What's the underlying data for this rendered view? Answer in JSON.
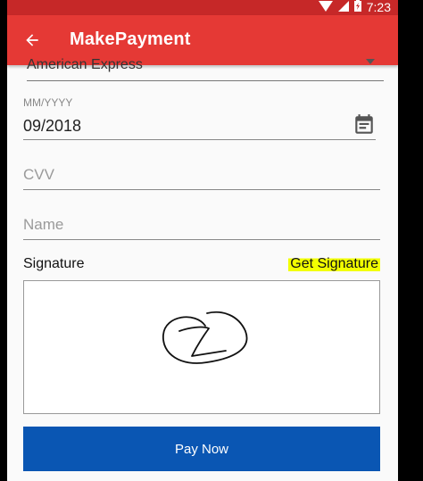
{
  "status_bar": {
    "time": "7:23",
    "icons": [
      "wifi-icon",
      "signal-icon",
      "battery-icon"
    ]
  },
  "appbar": {
    "title": "MakePayment",
    "back_icon": "arrow-back-icon"
  },
  "form": {
    "card_type": {
      "value": "American Express"
    },
    "expiry": {
      "label": "MM/YYYY",
      "value": "09/2018",
      "icon": "calendar-icon"
    },
    "cvv": {
      "placeholder": "CVV",
      "value": ""
    },
    "name": {
      "placeholder": "Name",
      "value": ""
    },
    "signature": {
      "label": "Signature",
      "action_label": "Get Signature"
    },
    "pay_button": {
      "label": "Pay Now"
    }
  },
  "colors": {
    "appbar": "#e53935",
    "status_bar": "#c62828",
    "pay_button": "#0a56b3",
    "highlight": "#f2ff00"
  }
}
